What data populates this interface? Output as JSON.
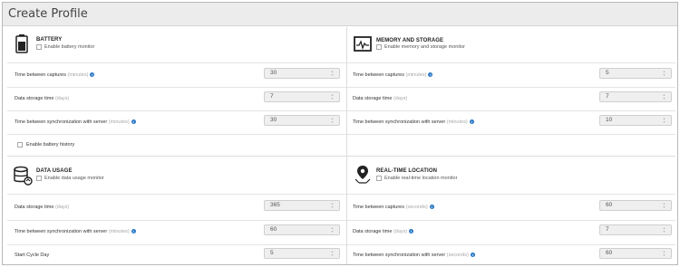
{
  "page_title": "Create Profile",
  "sections": {
    "battery": {
      "title": "BATTERY",
      "enable_label": "Enable battery monitor",
      "rows": [
        {
          "label": "Time between captures",
          "unit": "(minutes)",
          "info": true,
          "value": "30"
        },
        {
          "label": "Data storage time",
          "unit": "(days)",
          "info": false,
          "value": "7"
        },
        {
          "label": "Time between synchronization with server",
          "unit": "(minutes)",
          "info": true,
          "value": "30"
        }
      ],
      "history_label": "Enable battery history"
    },
    "memory": {
      "title": "MEMORY AND STORAGE",
      "enable_label": "Enable memory and storage monitor",
      "rows": [
        {
          "label": "Time between captures",
          "unit": "(minutes)",
          "info": true,
          "value": "5"
        },
        {
          "label": "Data storage time",
          "unit": "(days)",
          "info": false,
          "value": "7"
        },
        {
          "label": "Time between synchronization with server",
          "unit": "(minutes)",
          "info": true,
          "value": "10"
        }
      ]
    },
    "data_usage": {
      "title": "DATA USAGE",
      "enable_label": "Enable data usage monitor",
      "rows": [
        {
          "label": "Data storage time",
          "unit": "(days)",
          "info": false,
          "value": "365"
        },
        {
          "label": "Time between synchronization with server",
          "unit": "(minutes)",
          "info": true,
          "value": "60"
        },
        {
          "label": "Start Cycle Day",
          "unit": "",
          "info": false,
          "value": "5"
        }
      ]
    },
    "location": {
      "title": "REAL-TIME LOCATION",
      "enable_label": "Enable real-time location monitor",
      "rows": [
        {
          "label": "Time between captures",
          "unit": "(seconds)",
          "info": true,
          "value": "60"
        },
        {
          "label": "Data storage time",
          "unit": "(days)",
          "info": false,
          "value": "7"
        },
        {
          "label": "Time between synchronization with server",
          "unit": "(seconds)",
          "info": true,
          "value": "60"
        }
      ]
    }
  },
  "icons": {
    "battery": "battery-icon",
    "memory": "memory-chart-icon",
    "data_usage": "database-sync-icon",
    "location": "location-pin-icon",
    "info": "info-icon"
  },
  "colors": {
    "info_blue": "#2a78c4",
    "header_bg": "#ececec"
  }
}
